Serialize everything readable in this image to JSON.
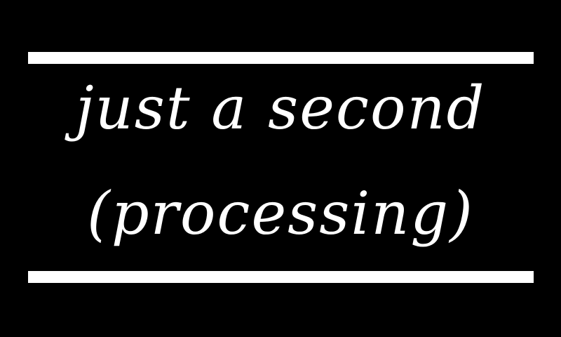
{
  "screen": {
    "line1": "just a second",
    "line2": "(processing)"
  },
  "colors": {
    "background": "#000000",
    "foreground": "#ffffff"
  }
}
